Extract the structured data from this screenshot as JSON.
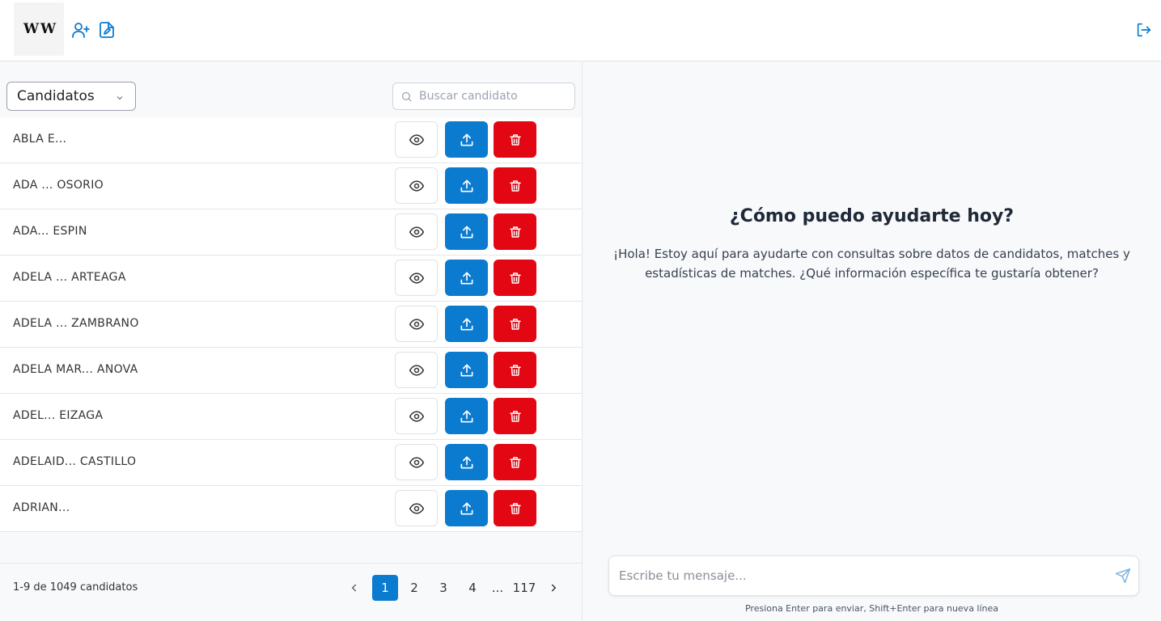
{
  "header": {
    "logo_text": "W W",
    "icons": [
      "user-plus-icon",
      "file-edit-icon",
      "logout-icon"
    ],
    "accent_color": "#0b7bd0"
  },
  "candidates_panel": {
    "select_value": "Candidatos",
    "search_placeholder": "Buscar candidato",
    "rows": [
      {
        "name": "ABLA E..."
      },
      {
        "name": "ADA ... OSORIO"
      },
      {
        "name": "ADA... ESPIN"
      },
      {
        "name": "ADELA ... ARTEAGA"
      },
      {
        "name": "ADELA ... ZAMBRANO"
      },
      {
        "name": "ADELA MAR... ANOVA"
      },
      {
        "name": "ADEL... EIZAGA"
      },
      {
        "name": "ADELAID... CASTILLO"
      },
      {
        "name": "ADRIAN..."
      }
    ],
    "actions": {
      "view_icon": "eye-icon",
      "upload_icon": "upload-icon",
      "delete_icon": "trash-icon",
      "upload_color": "#0b7bd0",
      "delete_color": "#e30613"
    },
    "footer": {
      "count_text": "1-9 de 1049 candidatos",
      "pages": [
        "1",
        "2",
        "3",
        "4",
        "...",
        "117"
      ],
      "current_page": "1"
    }
  },
  "chat_panel": {
    "title": "¿Cómo puedo ayudarte hoy?",
    "intro": "¡Hola! Estoy aquí para ayudarte con consultas sobre datos de candidatos, matches y estadísticas de matches. ¿Qué información específica te gustaría obtener?",
    "input_placeholder": "Escribe tu mensaje...",
    "hint": "Presiona Enter para enviar, Shift+Enter para nueva línea"
  }
}
